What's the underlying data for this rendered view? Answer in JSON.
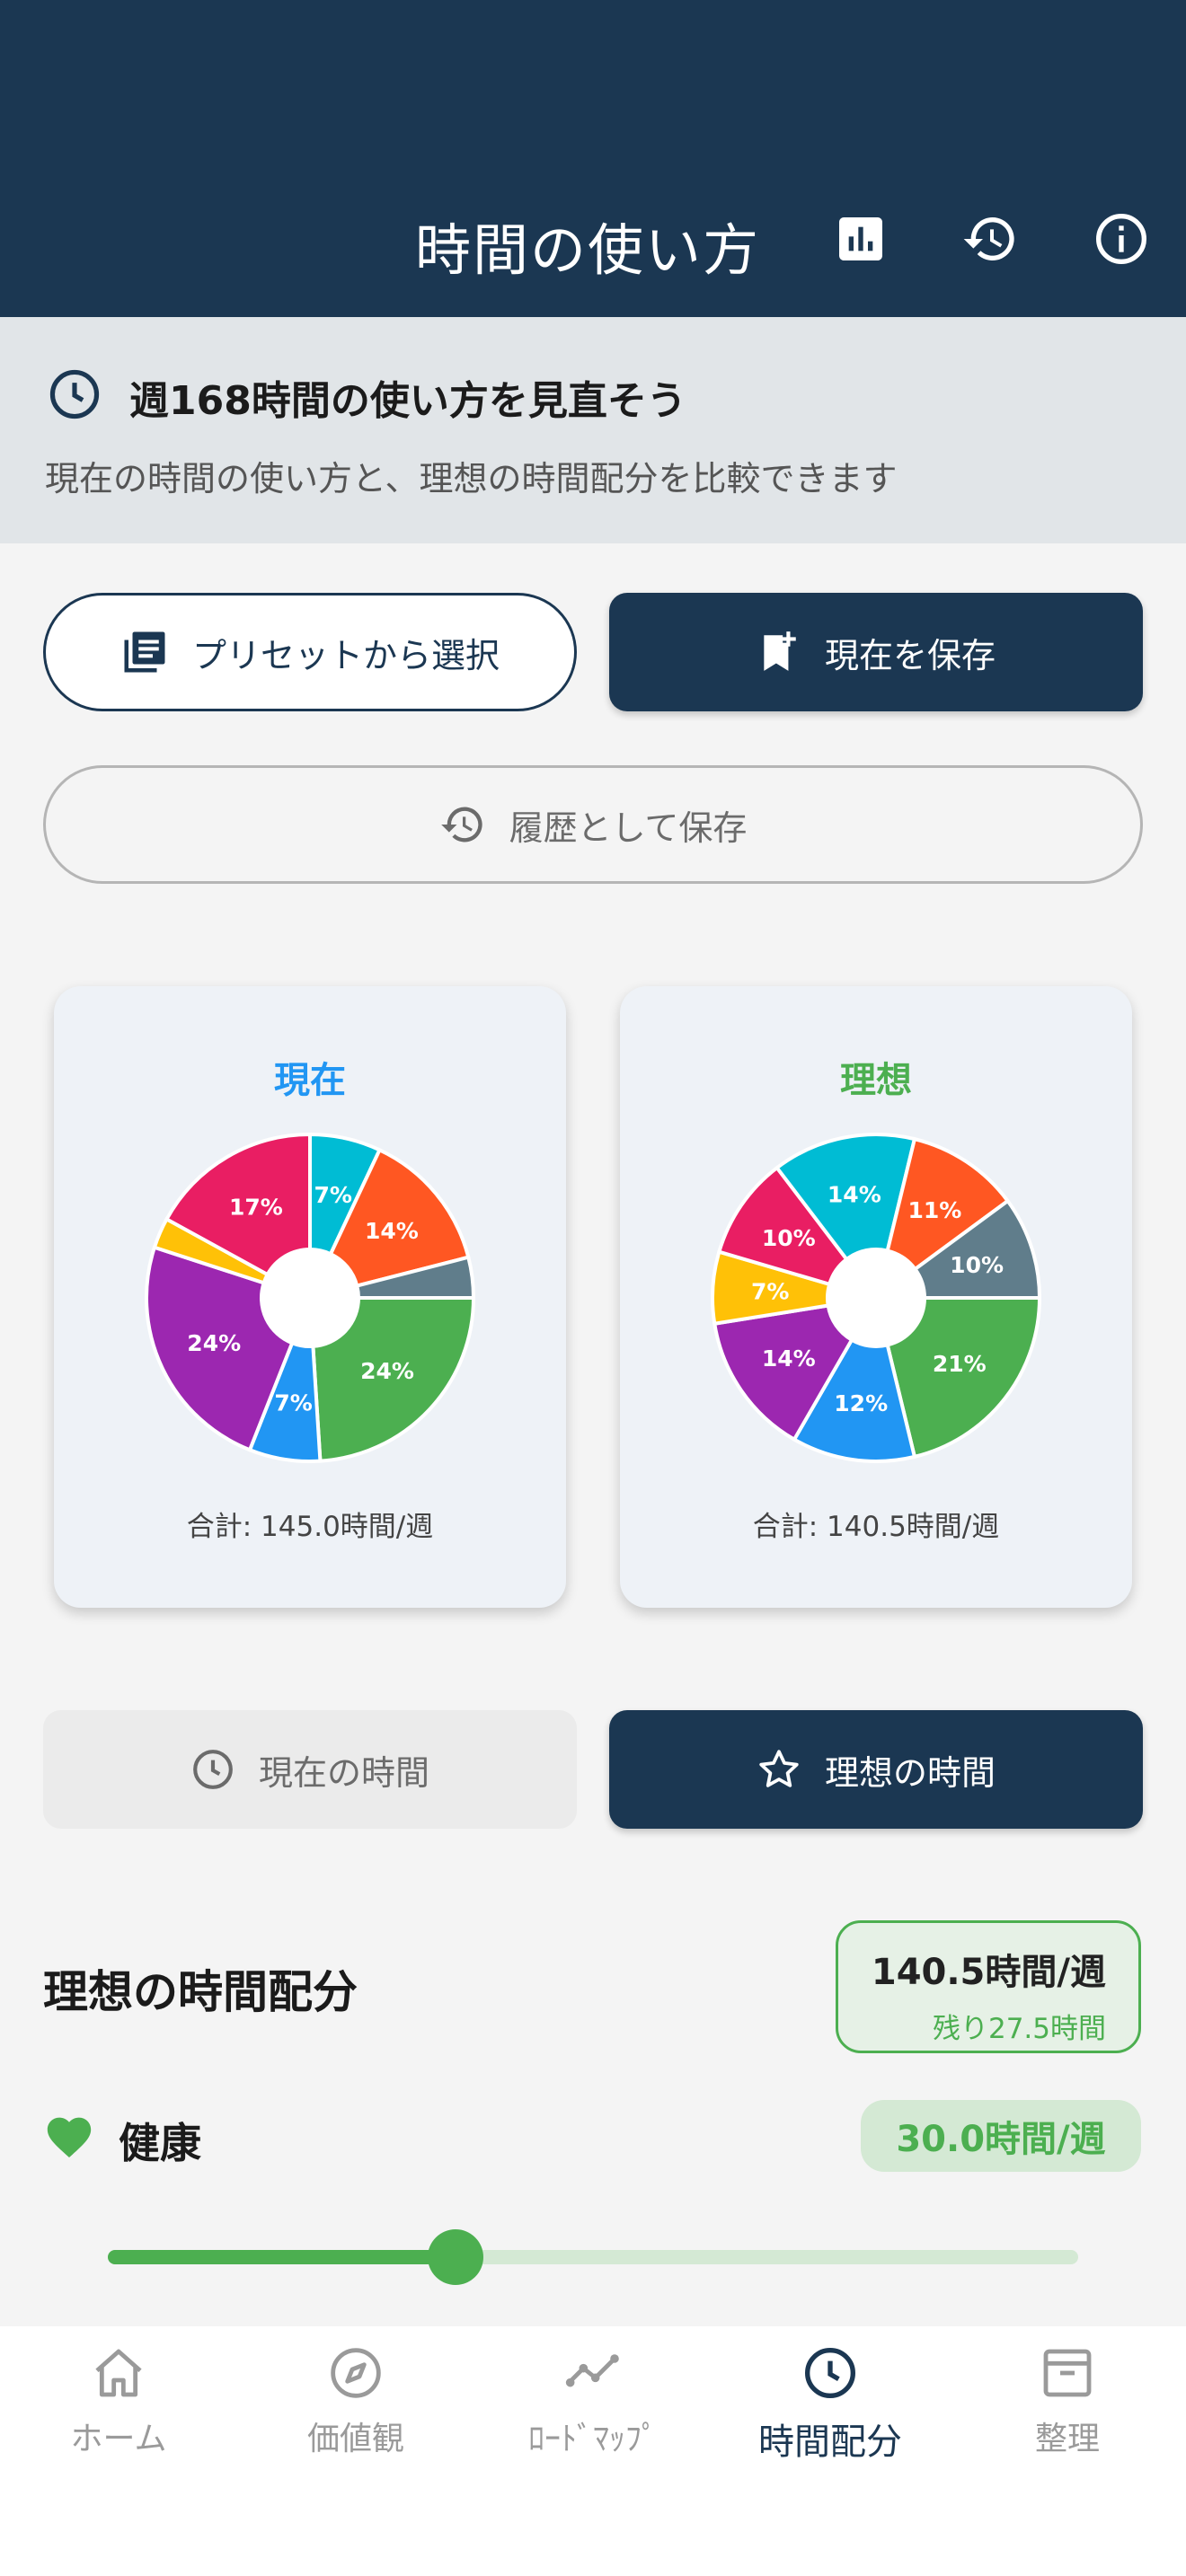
{
  "appbar": {
    "title": "時間の使い方",
    "icons": [
      "bar-chart-icon",
      "history-icon",
      "info-icon"
    ]
  },
  "banner": {
    "title": "週168時間の使い方を見直そう",
    "subtitle": "現在の時間の使い方と、理想の時間配分を比較できます"
  },
  "actions": {
    "preset_label": "プリセットから選択",
    "save_current_label": "現在を保存",
    "save_history_label": "履歴として保存"
  },
  "cards": {
    "current": {
      "title": "現在",
      "total": "合計: 145.0時間/週",
      "title_color": "#2196f3"
    },
    "ideal": {
      "title": "理想",
      "total": "合計: 140.5時間/週",
      "title_color": "#4caf50"
    }
  },
  "chart_data": [
    {
      "type": "pie",
      "title": "現在",
      "slices": [
        {
          "label": "24%",
          "value": 24,
          "color": "#4caf50"
        },
        {
          "label": "7%",
          "value": 7,
          "color": "#2196f3"
        },
        {
          "label": "24%",
          "value": 24,
          "color": "#9c27b0"
        },
        {
          "label": "",
          "value": 3,
          "color": "#ffc107"
        },
        {
          "label": "17%",
          "value": 17,
          "color": "#e91e63"
        },
        {
          "label": "7%",
          "value": 7,
          "color": "#00bcd4"
        },
        {
          "label": "14%",
          "value": 14,
          "color": "#ff5722"
        },
        {
          "label": "",
          "value": 4,
          "color": "#607d8b"
        }
      ]
    },
    {
      "type": "pie",
      "title": "理想",
      "slices": [
        {
          "label": "21%",
          "value": 21,
          "color": "#4caf50"
        },
        {
          "label": "12%",
          "value": 12,
          "color": "#2196f3"
        },
        {
          "label": "14%",
          "value": 14,
          "color": "#9c27b0"
        },
        {
          "label": "7%",
          "value": 7,
          "color": "#ffc107"
        },
        {
          "label": "10%",
          "value": 10,
          "color": "#e91e63"
        },
        {
          "label": "14%",
          "value": 14,
          "color": "#00bcd4"
        },
        {
          "label": "11%",
          "value": 11,
          "color": "#ff5722"
        },
        {
          "label": "10%",
          "value": 10,
          "color": "#607d8b"
        }
      ]
    }
  ],
  "toggle": {
    "current_label": "現在の時間",
    "ideal_label": "理想の時間",
    "selected": "ideal"
  },
  "allocation": {
    "title": "理想の時間配分",
    "summary_total": "140.5時間/週",
    "summary_remaining": "残り27.5時間",
    "category": {
      "name": "健康",
      "hours": "30.0時間/週",
      "icon": "heart-icon",
      "color": "#4caf50",
      "slider_fraction": 0.36
    }
  },
  "nav": {
    "items": [
      {
        "label": "ホーム",
        "icon": "home-icon"
      },
      {
        "label": "価値観",
        "icon": "compass-icon"
      },
      {
        "label": "ﾛｰﾄﾞﾏｯﾌﾟ",
        "icon": "roadmap-icon"
      },
      {
        "label": "時間配分",
        "icon": "clock-icon"
      },
      {
        "label": "整理",
        "icon": "archive-icon"
      }
    ],
    "active_index": 3
  },
  "colors": {
    "primary": "#1b3752",
    "accent_green": "#4caf50",
    "accent_blue": "#2196f3"
  }
}
